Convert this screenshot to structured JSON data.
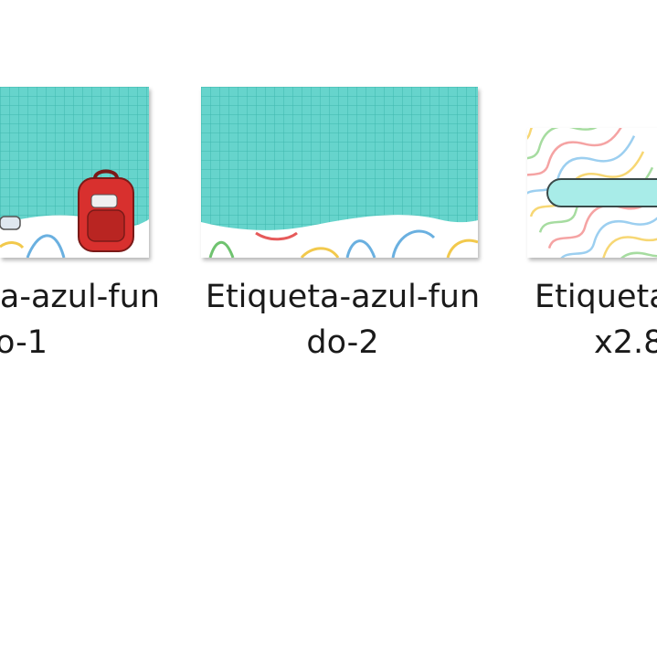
{
  "files": [
    {
      "name_line1": "a-azul-fun",
      "name_line2": "o-1",
      "thumb_icon": "backpack-icon"
    },
    {
      "name_line1": "Etiqueta-azul-fun",
      "name_line2": "do-2",
      "thumb_icon": "grid-paper-icon"
    },
    {
      "name_line1": "Etiqueta",
      "name_line2": "x2.8",
      "thumb_icon": "wavy-lines-icon"
    }
  ],
  "colors": {
    "grid_bg": "#66d4cc",
    "grid_line": "#3fb7ae",
    "backpack": "#d8302e",
    "label_bar": "#a8ece8"
  }
}
